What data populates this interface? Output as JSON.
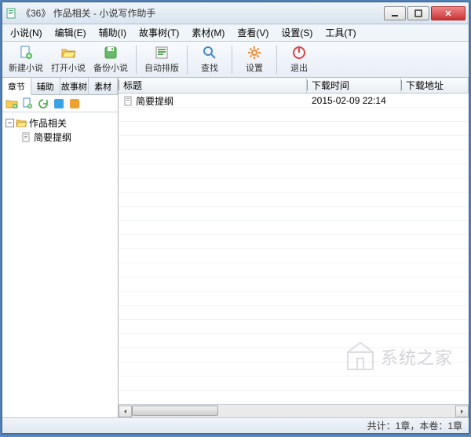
{
  "title": "《36》 作品相关 - 小说写作助手",
  "menu": [
    "小说(N)",
    "编辑(E)",
    "辅助(I)",
    "故事树(T)",
    "素材(M)",
    "查看(V)",
    "设置(S)",
    "工具(T)"
  ],
  "toolbar": {
    "new": "新建小说",
    "open": "打开小说",
    "backup": "备份小说",
    "layout": "自动排版",
    "find": "查找",
    "settings": "设置",
    "exit": "退出"
  },
  "tabs": [
    "章节",
    "辅助",
    "故事树",
    "素材"
  ],
  "tree": {
    "root": "作品相关",
    "child": "简要提纲"
  },
  "list": {
    "headers": {
      "title": "标题",
      "time": "下载时间",
      "url": "下载地址"
    },
    "rows": [
      {
        "title": "简要提纲",
        "time": "2015-02-09 22:14",
        "url": ""
      }
    ]
  },
  "status": "共计：1章，本卷：1章",
  "watermark": "系统之家"
}
